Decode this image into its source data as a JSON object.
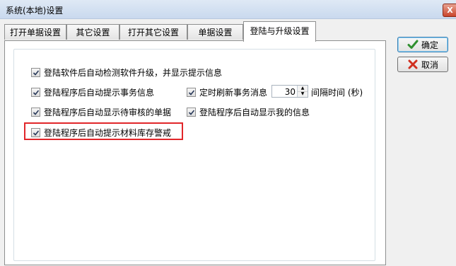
{
  "window": {
    "title": "系统(本地)设置",
    "close_glyph": "X"
  },
  "tabs": [
    {
      "label": "打开单据设置",
      "active": false
    },
    {
      "label": "其它设置",
      "active": false
    },
    {
      "label": "打开其它设置",
      "active": false
    },
    {
      "label": "单据设置",
      "active": false
    },
    {
      "label": "登陆与升级设置",
      "active": true
    }
  ],
  "options": {
    "auto_update_check": {
      "label": "登陆软件后自动检测软件升级，并显示提示信息",
      "checked": true
    },
    "remind_tasks": {
      "label": "登陆程序后自动提示事务信息",
      "checked": true
    },
    "refresh_tasks": {
      "label": "定时刷新事务消息",
      "checked": true
    },
    "show_pending_docs": {
      "label": "登陆程序后自动显示待审核的单据",
      "checked": true
    },
    "show_my_info": {
      "label": "登陆程序后自动显示我的信息",
      "checked": true
    },
    "stock_warning": {
      "label": "登陆程序后自动提示材料库存警戒",
      "checked": true
    }
  },
  "refresh_interval": {
    "value": "30",
    "unit_label": "间隔时间 (秒)"
  },
  "buttons": {
    "ok": {
      "label": "确定",
      "icon": "checkmark-icon"
    },
    "cancel": {
      "label": "取消",
      "icon": "x-icon"
    }
  },
  "colors": {
    "highlight_border": "#e1262a",
    "ok_icon": "#2f8f2f",
    "cancel_icon": "#d03020"
  }
}
